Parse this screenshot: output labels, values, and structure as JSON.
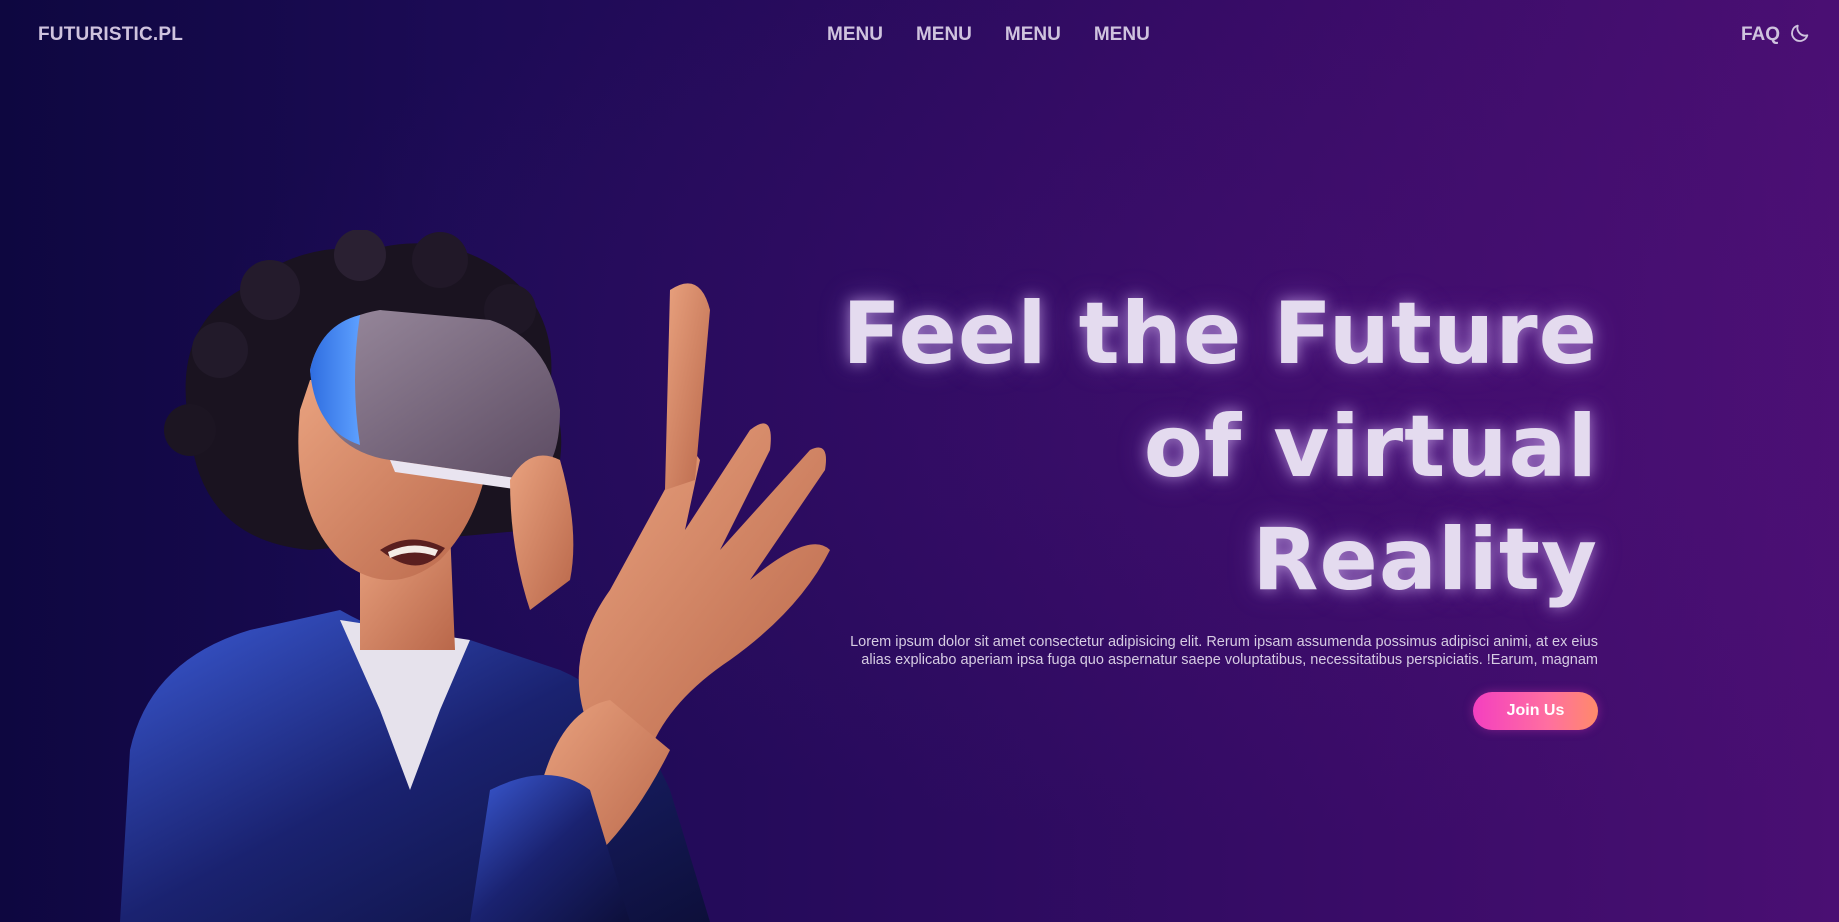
{
  "header": {
    "logo": "FUTURISTIC.PL",
    "nav": [
      "MENU",
      "MENU",
      "MENU",
      "MENU"
    ],
    "faq_label": "FAQ",
    "theme_icon": "moon-icon"
  },
  "hero": {
    "headline_lines": [
      "Feel the Future",
      "of virtual",
      "Reality"
    ],
    "description": "Lorem ipsum dolor sit amet consectetur adipisicing elit. Rerum ipsam assumenda possimus adipisci animi, at ex eius alias explicabo aperiam ipsa fuga quo aspernatur saepe voluptatibus, necessitatibus perspiciatis. !Earum, magnam",
    "join_button": "Join Us",
    "image": "woman-wearing-vr-headset"
  },
  "colors": {
    "background_left": "#0e0740",
    "background_right": "#4a0f73",
    "text": "#cfc3de",
    "button_gradient_start": "#f43fc0",
    "button_gradient_end": "#ff8a6a"
  }
}
